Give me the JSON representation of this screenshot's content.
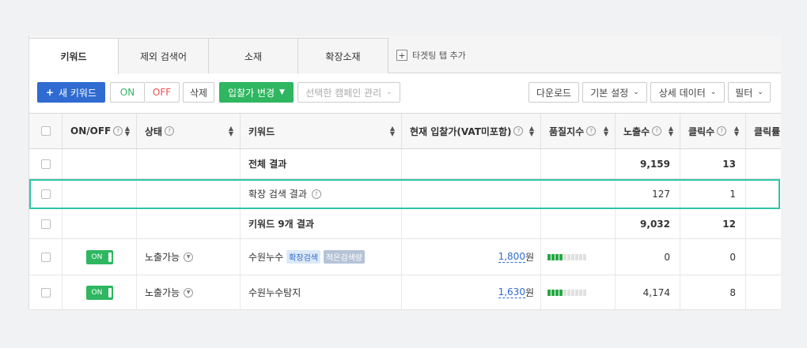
{
  "tabs": [
    {
      "label": "키워드"
    },
    {
      "label": "제외 검색어"
    },
    {
      "label": "소재"
    },
    {
      "label": "확장소재"
    }
  ],
  "tab_add_label": "타겟팅 탭 추가",
  "toolbar": {
    "new_keyword": "새 키워드",
    "on": "ON",
    "off": "OFF",
    "delete": "삭제",
    "bid_change": "입찰가 변경",
    "campaign_manage": "선택한 캠페인 관리",
    "download": "다운로드",
    "default_settings": "기본 설정",
    "detail_data": "상세 데이터",
    "filter": "필터"
  },
  "columns": {
    "onoff": "ON/OFF",
    "status": "상태",
    "keyword": "키워드",
    "bid": "현재 입찰가(VAT미포함)",
    "quality": "품질지수",
    "impressions": "노출수",
    "clicks": "클릭수",
    "ctr": "클릭률"
  },
  "summary_rows": [
    {
      "keyword": "전체 결과",
      "impressions": "9,159",
      "clicks": "13"
    },
    {
      "keyword": "확장 검색 결과",
      "impressions": "127",
      "clicks": "1"
    },
    {
      "keyword": "키워드 9개 결과",
      "impressions": "9,032",
      "clicks": "12"
    }
  ],
  "data_rows": [
    {
      "toggle": "ON",
      "status": "노출가능",
      "keyword": "수원누수",
      "tags": [
        "확장검색",
        "적은검색량"
      ],
      "bid": "1,800",
      "bid_unit": "원",
      "quality": 4,
      "impressions": "0",
      "clicks": "0"
    },
    {
      "toggle": "ON",
      "status": "노출가능",
      "keyword": "수원누수탐지",
      "tags": [],
      "bid": "1,630",
      "bid_unit": "원",
      "quality": 4,
      "impressions": "4,174",
      "clicks": "8"
    }
  ],
  "colors": {
    "primary": "#2f6bd1",
    "green": "#2eb760",
    "red": "#e8514b",
    "highlight": "#2ec4a6"
  }
}
